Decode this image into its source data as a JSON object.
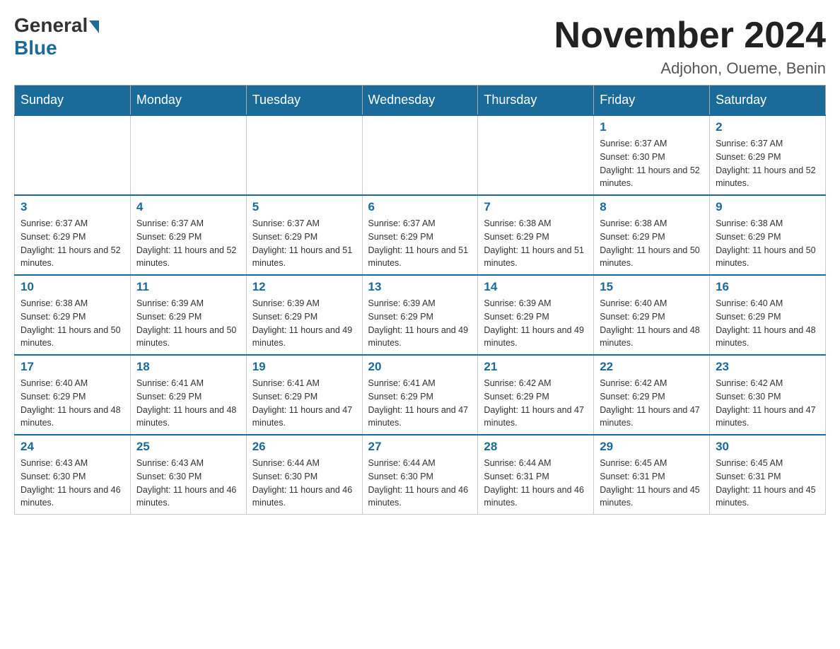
{
  "header": {
    "logo_general": "General",
    "logo_blue": "Blue",
    "month_title": "November 2024",
    "location": "Adjohon, Oueme, Benin"
  },
  "days_of_week": [
    "Sunday",
    "Monday",
    "Tuesday",
    "Wednesday",
    "Thursday",
    "Friday",
    "Saturday"
  ],
  "weeks": [
    [
      {
        "day": "",
        "info": ""
      },
      {
        "day": "",
        "info": ""
      },
      {
        "day": "",
        "info": ""
      },
      {
        "day": "",
        "info": ""
      },
      {
        "day": "",
        "info": ""
      },
      {
        "day": "1",
        "info": "Sunrise: 6:37 AM\nSunset: 6:30 PM\nDaylight: 11 hours and 52 minutes."
      },
      {
        "day": "2",
        "info": "Sunrise: 6:37 AM\nSunset: 6:29 PM\nDaylight: 11 hours and 52 minutes."
      }
    ],
    [
      {
        "day": "3",
        "info": "Sunrise: 6:37 AM\nSunset: 6:29 PM\nDaylight: 11 hours and 52 minutes."
      },
      {
        "day": "4",
        "info": "Sunrise: 6:37 AM\nSunset: 6:29 PM\nDaylight: 11 hours and 52 minutes."
      },
      {
        "day": "5",
        "info": "Sunrise: 6:37 AM\nSunset: 6:29 PM\nDaylight: 11 hours and 51 minutes."
      },
      {
        "day": "6",
        "info": "Sunrise: 6:37 AM\nSunset: 6:29 PM\nDaylight: 11 hours and 51 minutes."
      },
      {
        "day": "7",
        "info": "Sunrise: 6:38 AM\nSunset: 6:29 PM\nDaylight: 11 hours and 51 minutes."
      },
      {
        "day": "8",
        "info": "Sunrise: 6:38 AM\nSunset: 6:29 PM\nDaylight: 11 hours and 50 minutes."
      },
      {
        "day": "9",
        "info": "Sunrise: 6:38 AM\nSunset: 6:29 PM\nDaylight: 11 hours and 50 minutes."
      }
    ],
    [
      {
        "day": "10",
        "info": "Sunrise: 6:38 AM\nSunset: 6:29 PM\nDaylight: 11 hours and 50 minutes."
      },
      {
        "day": "11",
        "info": "Sunrise: 6:39 AM\nSunset: 6:29 PM\nDaylight: 11 hours and 50 minutes."
      },
      {
        "day": "12",
        "info": "Sunrise: 6:39 AM\nSunset: 6:29 PM\nDaylight: 11 hours and 49 minutes."
      },
      {
        "day": "13",
        "info": "Sunrise: 6:39 AM\nSunset: 6:29 PM\nDaylight: 11 hours and 49 minutes."
      },
      {
        "day": "14",
        "info": "Sunrise: 6:39 AM\nSunset: 6:29 PM\nDaylight: 11 hours and 49 minutes."
      },
      {
        "day": "15",
        "info": "Sunrise: 6:40 AM\nSunset: 6:29 PM\nDaylight: 11 hours and 48 minutes."
      },
      {
        "day": "16",
        "info": "Sunrise: 6:40 AM\nSunset: 6:29 PM\nDaylight: 11 hours and 48 minutes."
      }
    ],
    [
      {
        "day": "17",
        "info": "Sunrise: 6:40 AM\nSunset: 6:29 PM\nDaylight: 11 hours and 48 minutes."
      },
      {
        "day": "18",
        "info": "Sunrise: 6:41 AM\nSunset: 6:29 PM\nDaylight: 11 hours and 48 minutes."
      },
      {
        "day": "19",
        "info": "Sunrise: 6:41 AM\nSunset: 6:29 PM\nDaylight: 11 hours and 47 minutes."
      },
      {
        "day": "20",
        "info": "Sunrise: 6:41 AM\nSunset: 6:29 PM\nDaylight: 11 hours and 47 minutes."
      },
      {
        "day": "21",
        "info": "Sunrise: 6:42 AM\nSunset: 6:29 PM\nDaylight: 11 hours and 47 minutes."
      },
      {
        "day": "22",
        "info": "Sunrise: 6:42 AM\nSunset: 6:29 PM\nDaylight: 11 hours and 47 minutes."
      },
      {
        "day": "23",
        "info": "Sunrise: 6:42 AM\nSunset: 6:30 PM\nDaylight: 11 hours and 47 minutes."
      }
    ],
    [
      {
        "day": "24",
        "info": "Sunrise: 6:43 AM\nSunset: 6:30 PM\nDaylight: 11 hours and 46 minutes."
      },
      {
        "day": "25",
        "info": "Sunrise: 6:43 AM\nSunset: 6:30 PM\nDaylight: 11 hours and 46 minutes."
      },
      {
        "day": "26",
        "info": "Sunrise: 6:44 AM\nSunset: 6:30 PM\nDaylight: 11 hours and 46 minutes."
      },
      {
        "day": "27",
        "info": "Sunrise: 6:44 AM\nSunset: 6:30 PM\nDaylight: 11 hours and 46 minutes."
      },
      {
        "day": "28",
        "info": "Sunrise: 6:44 AM\nSunset: 6:31 PM\nDaylight: 11 hours and 46 minutes."
      },
      {
        "day": "29",
        "info": "Sunrise: 6:45 AM\nSunset: 6:31 PM\nDaylight: 11 hours and 45 minutes."
      },
      {
        "day": "30",
        "info": "Sunrise: 6:45 AM\nSunset: 6:31 PM\nDaylight: 11 hours and 45 minutes."
      }
    ]
  ]
}
